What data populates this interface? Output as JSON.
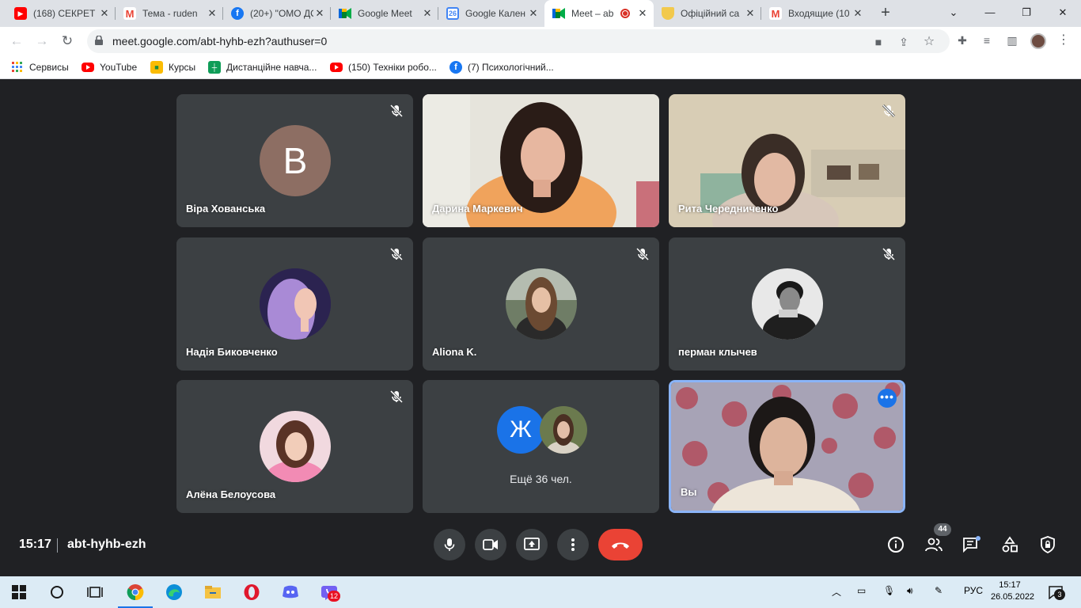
{
  "browser": {
    "tabs": [
      {
        "title": "(168) СЕКРЕТ",
        "icon": "youtube-icon",
        "color": "#ff0000"
      },
      {
        "title": "Тема - ruden",
        "icon": "gmail-icon",
        "color": "#ea4335"
      },
      {
        "title": "(20+) \"ОМО ДО",
        "icon": "facebook-icon",
        "color": "#1877f2"
      },
      {
        "title": "Google Meet",
        "icon": "google-meet-icon",
        "color": "#00897b"
      },
      {
        "title": "Google Кален",
        "icon": "google-calendar-icon",
        "color": "#4285f4",
        "glyph": "26"
      },
      {
        "title": "Meet – ab",
        "icon": "google-meet-icon",
        "color": "#00897b",
        "active": true,
        "recording": true
      },
      {
        "title": "Офіційний са",
        "icon": "coat-of-arms-icon",
        "color": "#f2c94c"
      },
      {
        "title": "Входящие (10",
        "icon": "gmail-icon",
        "color": "#ea4335"
      }
    ],
    "url": "meet.google.com/abt-hyhb-ezh?authuser=0",
    "bookmarks": [
      {
        "label": "Сервисы",
        "icon": "apps-grid-icon"
      },
      {
        "label": "YouTube",
        "icon": "youtube-icon"
      },
      {
        "label": "Курсы",
        "icon": "classroom-icon"
      },
      {
        "label": "Дистанційне навча...",
        "icon": "sheets-icon"
      },
      {
        "label": "(150) Техніки робо...",
        "icon": "youtube-icon"
      },
      {
        "label": "(7) Психологічний...",
        "icon": "facebook-icon"
      }
    ]
  },
  "meet": {
    "participants": [
      {
        "name": "Віра Хованська",
        "type": "letter",
        "letter": "В",
        "muted": true
      },
      {
        "name": "Дарина Маркевич",
        "type": "video",
        "muted": false
      },
      {
        "name": "Рита Чередниченко",
        "type": "video",
        "muted": true
      },
      {
        "name": "Надія Биковченко",
        "type": "photo",
        "muted": true
      },
      {
        "name": "Aliona K.",
        "type": "photo",
        "muted": true
      },
      {
        "name": "перман клычев",
        "type": "photo",
        "muted": true
      },
      {
        "name": "Алёна Белоусова",
        "type": "photo",
        "muted": true
      }
    ],
    "more": {
      "letter": "Ж",
      "label": "Ещё 36 чел."
    },
    "self": {
      "name": "Вы"
    },
    "time": "15:17",
    "meeting_code": "abt-hyhb-ezh",
    "people_count": "44",
    "colors": {
      "background": "#202124",
      "tile": "#3c4043",
      "end_call": "#ea4335",
      "accent": "#1a73e8"
    }
  },
  "taskbar": {
    "language": "РУС",
    "time": "15:17",
    "date": "26.05.2022",
    "viber_badge": "12",
    "notification_count": "3"
  }
}
